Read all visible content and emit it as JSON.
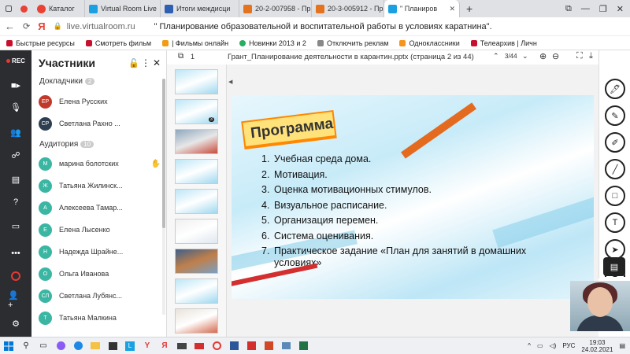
{
  "browser": {
    "tabs": [
      {
        "label": "Каталог",
        "icon_color": "#e94235"
      },
      {
        "label": "Virtual Room Live",
        "icon_color": "#1ba1e2"
      },
      {
        "label": "Итоги междисци",
        "icon_color": "#2f5fb0"
      },
      {
        "label": "20-2-007958 - Пр",
        "icon_color": "#e5731d"
      },
      {
        "label": "20-3-005912 - Пр",
        "icon_color": "#e5731d"
      },
      {
        "label": "\" Планиров",
        "icon_color": "#1ba1e2"
      }
    ],
    "url": "live.virtualroom.ru",
    "page_title": "\" Планирование образовательной и воспитательной работы в условиях каратнина\".",
    "bookmarks": [
      {
        "label": "Быстрые ресурсы",
        "icon_color": "#c8102e"
      },
      {
        "label": "Смотреть фильм",
        "icon_color": "#c8102e"
      },
      {
        "label": "| Фильмы онлайн",
        "icon_color": "#f39c12"
      },
      {
        "label": "Новинки 2013 и 2",
        "icon_color": "#27ae60"
      },
      {
        "label": "Отключить реклам",
        "icon_color": "#888888"
      },
      {
        "label": "Одноклассники",
        "icon_color": "#f7931e"
      },
      {
        "label": "Телеархив | Личн",
        "icon_color": "#c8102e"
      }
    ]
  },
  "left_bar": {
    "rec_label": "REC"
  },
  "participants": {
    "title": "Участники",
    "speakers_label": "Докладчики",
    "speakers_count": "2",
    "speakers": [
      {
        "initials": "ЕР",
        "name": "Елена Русских",
        "color": "#c0392b"
      },
      {
        "initials": "СР",
        "name": "Светлана Рахно ...",
        "color": "#2c3e50"
      }
    ],
    "audience_label": "Аудитория",
    "audience_count": "10",
    "audience": [
      {
        "initials": "М",
        "name": "марина болотских",
        "color": "#3bb6a3"
      },
      {
        "initials": "Ж",
        "name": "Татьяна Жилинск...",
        "color": "#3bb6a3"
      },
      {
        "initials": "А",
        "name": "Алексеева Тамар...",
        "color": "#3bb6a3"
      },
      {
        "initials": "Е",
        "name": "Елена Лысенко",
        "color": "#3bb6a3"
      },
      {
        "initials": "Н",
        "name": "Надежда Шрайне...",
        "color": "#3bb6a3"
      },
      {
        "initials": "О",
        "name": "Ольга Иванова",
        "color": "#3bb6a3"
      },
      {
        "initials": "СЛ",
        "name": "Светлана Лубянс...",
        "color": "#3bb6a3"
      },
      {
        "initials": "Т",
        "name": "Татьяна Малкина",
        "color": "#3bb6a3"
      }
    ]
  },
  "viewer": {
    "page_input": "1",
    "doc_title": "Грант_Планирование деятельности в карантин.pptx (страница 2 из 44)",
    "page_counter": "3/44",
    "thumb_badge": "3"
  },
  "slide": {
    "title": "Программа",
    "items": [
      {
        "num": "1.",
        "text": "Учебная среда дома."
      },
      {
        "num": "2.",
        "text": "Мотивация."
      },
      {
        "num": "3.",
        "text": "Оценка мотивационных стимулов."
      },
      {
        "num": "4.",
        "text": "Визуальное расписание."
      },
      {
        "num": "5.",
        "text": "Организация перемен."
      },
      {
        "num": "6.",
        "text": "Система оценивания."
      },
      {
        "num": "7.",
        "text": "Практическое задание «План для занятий в домашних условиях»"
      }
    ]
  },
  "taskbar": {
    "lang": "РУС",
    "time": "19:03",
    "date": "24.02.2021"
  }
}
